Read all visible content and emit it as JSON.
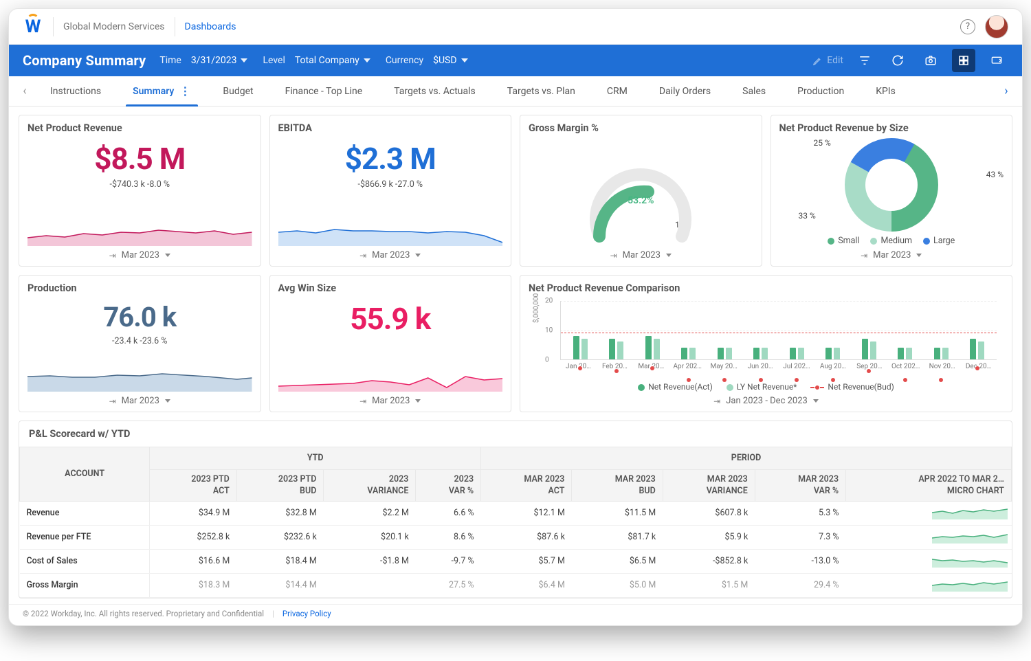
{
  "header": {
    "org": "Global Modern Services",
    "breadcrumb": "Dashboards"
  },
  "bluebar": {
    "title": "Company Summary",
    "time_label": "Time",
    "time_value": "3/31/2023",
    "level_label": "Level",
    "level_value": "Total Company",
    "currency_label": "Currency",
    "currency_value": "$USD",
    "edit": "Edit"
  },
  "tabs": [
    "Instructions",
    "Summary",
    "Budget",
    "Finance - Top Line",
    "Targets vs. Actuals",
    "Targets vs. Plan",
    "CRM",
    "Daily Orders",
    "Sales",
    "Production",
    "KPIs"
  ],
  "active_tab": 1,
  "cards": {
    "npr": {
      "title": "Net Product Revenue",
      "value": "$8.5 M",
      "delta": "-$740.3 k   -8.0 %",
      "footer": "Mar 2023"
    },
    "ebitda": {
      "title": "EBITDA",
      "value": "$2.3 M",
      "delta": "-$866.9 k   -27.0 %",
      "footer": "Mar 2023"
    },
    "gm": {
      "title": "Gross Margin %",
      "value": "53.2%",
      "min": "0",
      "max": "100",
      "footer": "Mar 2023"
    },
    "nprsize": {
      "title": "Net Product Revenue by Size",
      "labels": {
        "top": "25 %",
        "right": "43 %",
        "left": "33 %"
      },
      "legend": [
        "Small",
        "Medium",
        "Large"
      ],
      "footer": "Mar 2023"
    },
    "prod": {
      "title": "Production",
      "value": "76.0 k",
      "delta": "-23.4 k   -23.6 %",
      "footer": "Mar 2023"
    },
    "avgwin": {
      "title": "Avg Win Size",
      "value": "55.9 k",
      "footer": "Mar 2023"
    },
    "comp": {
      "title": "Net Product Revenue Comparison",
      "ylabel": "$,000,000",
      "yticks": [
        "20",
        "10",
        "0"
      ],
      "legend": [
        "Net Revenue(Act)",
        "LY Net Revenue*",
        "Net Revenue(Bud)"
      ],
      "footer": "Jan 2023 - Dec 2023"
    }
  },
  "table": {
    "title": "P&L Scorecard w/ YTD",
    "group_headers": [
      "ACCOUNT",
      "YTD",
      "PERIOD"
    ],
    "headers_ytd": [
      "2023 PTD ACT",
      "2023 PTD BUD",
      "2023 VARIANCE",
      "2023 VAR %"
    ],
    "headers_period": [
      "MAR 2023 ACT",
      "MAR 2023 BUD",
      "MAR 2023 VARIANCE",
      "MAR 2023 VAR %",
      "APR 2022 TO MAR 2… MICRO CHART"
    ],
    "rows": [
      {
        "acct": "Revenue",
        "c": [
          "$34.9 M",
          "$32.8 M",
          "$2.2 M",
          "6.6 %",
          "$12.1 M",
          "$11.5 M",
          "$607.8 k",
          "5.3 %"
        ]
      },
      {
        "acct": "Revenue per FTE",
        "c": [
          "$252.8 k",
          "$232.6 k",
          "$20.1 k",
          "8.6 %",
          "$87.6 k",
          "$81.7 k",
          "$5.9 k",
          "7.3 %"
        ]
      },
      {
        "acct": "Cost of Sales",
        "c": [
          "$16.6 M",
          "$18.4 M",
          "-$1.8 M",
          "-9.7 %",
          "$5.7 M",
          "$6.5 M",
          "-$852.8 k",
          "-13.0 %"
        ]
      },
      {
        "acct": "Gross Margin",
        "c": [
          "$18.3 M",
          "$14.4 M",
          "",
          "27.5 %",
          "$6.4 M",
          "$5.0 M",
          "$1.5 M",
          "29.4 %"
        ]
      }
    ]
  },
  "footer": {
    "copyright": "© 2022 Workday, Inc. All rights reserved. Proprietary and Confidential",
    "privacy": "Privacy Policy"
  },
  "chart_data": [
    {
      "name": "Net Product Revenue sparkline",
      "type": "area",
      "x_range": "trailing 12 mo",
      "values": [
        7.9,
        8.2,
        8.0,
        8.4,
        8.3,
        8.6,
        8.5,
        8.8,
        8.6,
        8.4,
        8.7,
        8.5
      ],
      "unit": "$M"
    },
    {
      "name": "EBITDA sparkline",
      "type": "area",
      "values": [
        2.9,
        3.0,
        2.8,
        3.1,
        3.0,
        3.0,
        2.9,
        2.9,
        2.8,
        2.9,
        2.8,
        2.3
      ],
      "unit": "$M"
    },
    {
      "name": "Gross Margin % gauge",
      "type": "gauge",
      "value": 53.2,
      "min": 0,
      "max": 100,
      "unit": "%"
    },
    {
      "name": "Net Product Revenue by Size",
      "type": "pie",
      "series": [
        {
          "name": "Small",
          "value": 43
        },
        {
          "name": "Medium",
          "value": 33
        },
        {
          "name": "Large",
          "value": 25
        }
      ],
      "note": "label order on chart clockwise from top-left: 25%, 43%, 33%",
      "unit": "%"
    },
    {
      "name": "Production sparkline",
      "type": "area",
      "values": [
        95,
        96,
        94,
        94,
        97,
        96,
        99,
        97,
        95,
        93,
        90,
        76
      ],
      "unit": "k"
    },
    {
      "name": "Avg Win Size sparkline",
      "type": "area",
      "values": [
        48,
        49,
        50,
        51,
        52,
        55,
        53,
        50,
        57,
        46,
        58,
        56
      ],
      "unit": "k"
    },
    {
      "name": "Net Product Revenue Comparison",
      "type": "bar",
      "ylabel": "$,000,000",
      "ylim": [
        0,
        20
      ],
      "categories": [
        "Jan 20…",
        "Feb 20…",
        "Mar 20…",
        "Apr 202…",
        "May 20…",
        "Jun 20…",
        "Jul 202…",
        "Aug 20…",
        "Sep 20…",
        "Oct 202…",
        "Nov 20…",
        "Dec 20…"
      ],
      "series": [
        {
          "name": "Net Revenue(Act)",
          "values": [
            8,
            7,
            8,
            4,
            4,
            4,
            4,
            4,
            7,
            4,
            4,
            7
          ]
        },
        {
          "name": "LY Net Revenue*",
          "values": [
            7,
            6,
            7,
            4,
            4,
            4,
            4,
            4,
            6,
            4,
            4,
            6
          ]
        },
        {
          "name": "Net Revenue(Bud)",
          "type": "line",
          "values": [
            9,
            9,
            9,
            9,
            9,
            9,
            9,
            9,
            9,
            9,
            9,
            10
          ]
        }
      ]
    }
  ]
}
